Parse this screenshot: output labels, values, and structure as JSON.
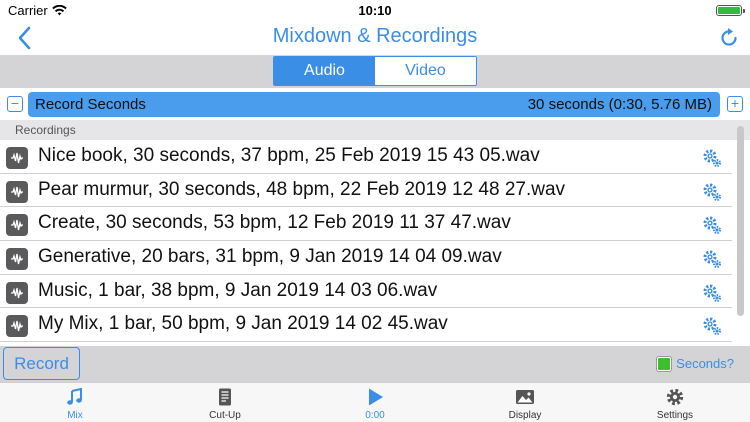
{
  "status_bar": {
    "carrier": "Carrier",
    "time": "10:10"
  },
  "nav": {
    "title": "Mixdown & Recordings",
    "back_icon": "chevron-left-icon",
    "refresh_icon": "refresh-icon"
  },
  "segments": {
    "options": [
      "Audio",
      "Video"
    ],
    "selected": "Audio"
  },
  "record_seconds": {
    "label": "Record Seconds",
    "value": "30 seconds (0:30, 5.76 MB)"
  },
  "section": {
    "title": "Recordings"
  },
  "recordings": [
    "Nice book, 30 seconds, 37 bpm, 25 Feb 2019 15 43 05.wav",
    "Pear murmur, 30 seconds, 48 bpm, 22 Feb 2019 12 48 27.wav",
    "Create, 30 seconds, 53 bpm, 12 Feb 2019 11 37 47.wav",
    "Generative, 20 bars, 31 bpm, 9 Jan 2019 14 04 09.wav",
    "Music, 1 bar, 38 bpm, 9 Jan 2019 14 03 06.wav",
    "My Mix, 1 bar, 50 bpm, 9 Jan 2019 14 02 45.wav"
  ],
  "action_bar": {
    "record_label": "Record",
    "seconds_toggle_label": "Seconds?",
    "seconds_checked": true
  },
  "tabs": [
    {
      "label": "Mix",
      "icon": "music-note-icon"
    },
    {
      "label": "Cut-Up",
      "icon": "document-icon"
    },
    {
      "label": "0:00",
      "icon": "play-icon"
    },
    {
      "label": "Display",
      "icon": "image-icon"
    },
    {
      "label": "Settings",
      "icon": "gear-icon"
    }
  ],
  "colors": {
    "accent": "#3a8ee6",
    "toolbar_gray": "#d4d4d6",
    "checkbox_green": "#3fbf2e"
  }
}
